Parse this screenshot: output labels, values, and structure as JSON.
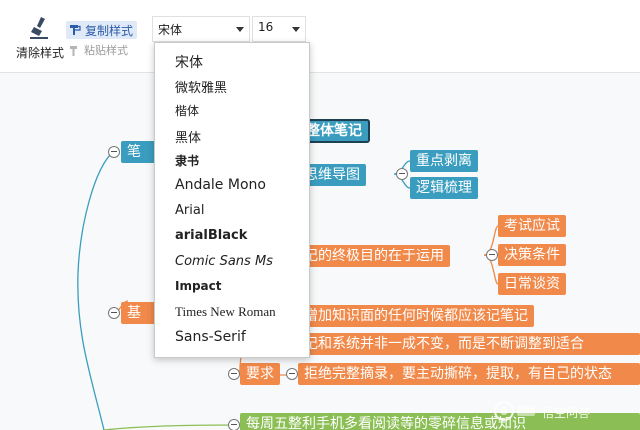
{
  "toolbar": {
    "clear_format_label": "清除样式",
    "copy_format_label": "复制样式",
    "paste_format_label": "粘贴样式",
    "font_family_value": "宋体",
    "font_size_value": "16"
  },
  "font_menu": {
    "options": [
      "宋体",
      "微软雅黑",
      "楷体",
      "黑体",
      "隶书",
      "Andale Mono",
      "Arial",
      "arialBlack",
      "Comic Sans Ms",
      "Impact",
      "Times New Roman",
      "Sans-Serif"
    ]
  },
  "mindmap": {
    "branch_1": "笔",
    "branch_2": "基",
    "root_tail": "录整体笔记",
    "mindmap_node": "成思维导图",
    "key_point": "重点剥离",
    "logic": "逻辑梳理",
    "purpose": "笔记的终极目的在于运用",
    "exam": "考试应试",
    "decision": "决策条件",
    "daily": "日常谈资",
    "increase": "增加知识面的任何时候都应该记笔记",
    "system": "笔记和系统并非一成不变，而是不断调整到适合",
    "requirement": "要求",
    "refuse": "拒绝完整摘录，要主动撕碎，提取，有自己的状态",
    "weekly": "每周五整利手机多看阅读等的零碎信息或知识"
  },
  "watermark": {
    "text": "悟空问答"
  },
  "colors": {
    "teal": "#3a9dbf",
    "orange": "#f0894a",
    "green": "#8bbf56",
    "accent": "#2c5da8"
  }
}
